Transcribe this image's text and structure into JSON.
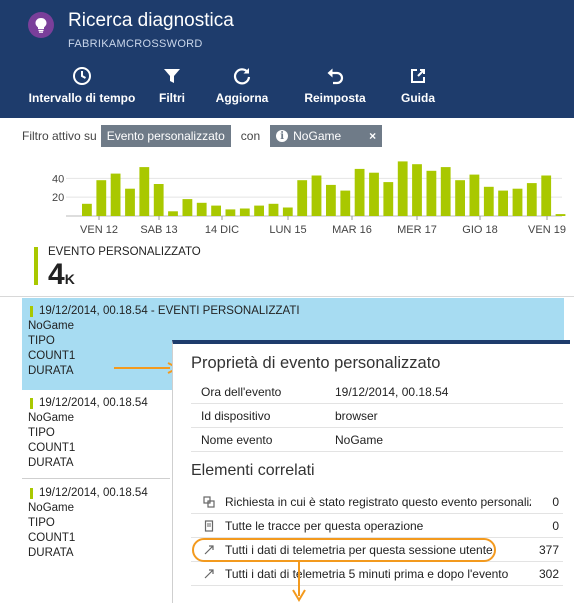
{
  "header": {
    "title": "Ricerca diagnostica",
    "subtitle": "FABRIKAMCROSSWORD",
    "icon": "lightbulb-icon"
  },
  "toolbar": {
    "time_range": "Intervallo di tempo",
    "filters": "Filtri",
    "refresh": "Aggiorna",
    "reset": "Reimposta",
    "help": "Guida"
  },
  "filter": {
    "prefix": "Filtro attivo su",
    "type": "Evento personalizzato",
    "connector": "con",
    "value": "NoGame",
    "remove": "×"
  },
  "chart_data": {
    "type": "bar",
    "color": "#a9c800",
    "y_ticks": [
      "40",
      "20"
    ],
    "ylim": [
      0,
      68
    ],
    "x_labels": [
      "VEN 12",
      "SAB 13",
      "14 DIC",
      "LUN 15",
      "MAR 16",
      "MER 17",
      "GIO 18",
      "VEN 19"
    ],
    "values": [
      13,
      38,
      45,
      29,
      52,
      34,
      5,
      18,
      14,
      11,
      7,
      8,
      11,
      13,
      9,
      38,
      43,
      33,
      27,
      50,
      46,
      36,
      58,
      55,
      48,
      52,
      38,
      44,
      31,
      27,
      29,
      35,
      43,
      2
    ]
  },
  "metric": {
    "label": "EVENTO PERSONALIZZATO",
    "value": "4",
    "unit": "K"
  },
  "events": [
    {
      "title": "19/12/2014, 00.18.54 - EVENTI PERSONALIZZATI",
      "fields": [
        "NoGame",
        "TIPO",
        "COUNT1",
        "DURATA"
      ]
    },
    {
      "title": "19/12/2014, 00.18.54",
      "fields": [
        "NoGame",
        "TIPO",
        "COUNT1",
        "DURATA"
      ]
    },
    {
      "title": "19/12/2014, 00.18.54",
      "fields": [
        "NoGame",
        "TIPO",
        "COUNT1",
        "DURATA"
      ]
    }
  ],
  "details": {
    "title": "Proprietà di evento personalizzato",
    "properties": [
      {
        "key": "Ora dell'evento",
        "value": "19/12/2014, 00.18.54"
      },
      {
        "key": "Id dispositivo",
        "value": "browser"
      },
      {
        "key": "Nome evento",
        "value": "NoGame"
      }
    ],
    "related_title": "Elementi correlati",
    "related": [
      {
        "icon": "request-icon",
        "text": "Richiesta in cui è stato registrato questo evento personalizzato",
        "count": "0"
      },
      {
        "icon": "trace-icon",
        "text": "Tutte le tracce per questa operazione",
        "count": "0"
      },
      {
        "icon": "link-icon",
        "text": "Tutti i dati di telemetria per questa sessione utente",
        "count": "377"
      },
      {
        "icon": "link-icon",
        "text": "Tutti i dati di telemetria 5 minuti prima e dopo l'evento",
        "count": "302"
      }
    ]
  },
  "colors": {
    "header_bg": "#1e3c6c",
    "accent_bar": "#a9c800",
    "selection": "#a7dcf2",
    "highlight": "#f39a1e"
  }
}
